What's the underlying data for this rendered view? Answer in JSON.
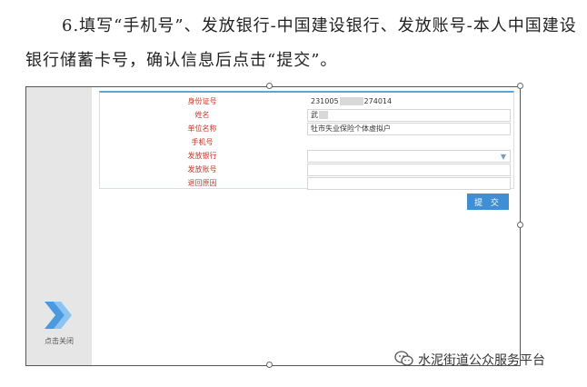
{
  "instruction": {
    "line1": "6.填写“手机号”、发放银行-中国建设银行、发放账号-本人中国建设银行储蓄卡号，确认信息后点击“提交”。"
  },
  "form": {
    "fields": [
      {
        "label": "身份证号",
        "value_prefix": "231005",
        "value_suffix": "274014"
      },
      {
        "label": "姓名",
        "value_prefix": "武",
        "value_suffix": ""
      },
      {
        "label": "单位名称",
        "value": "牡市失业保险个体虚拟户"
      },
      {
        "label": "手机号",
        "value": ""
      },
      {
        "label": "发放银行",
        "value": ""
      },
      {
        "label": "发放账号",
        "value": ""
      },
      {
        "label": "退回原因",
        "value": ""
      }
    ],
    "submit_label": "提 交"
  },
  "sidebar": {
    "close_label": "点击关闭",
    "icon": "double-chevron-right-icon"
  },
  "watermark": {
    "text": "水泥街道公众服务平台",
    "icon": "wechat-icon"
  },
  "colors": {
    "label": "#c0392b",
    "accent": "#3f8fd6",
    "chevron": "#4a9ae0"
  }
}
